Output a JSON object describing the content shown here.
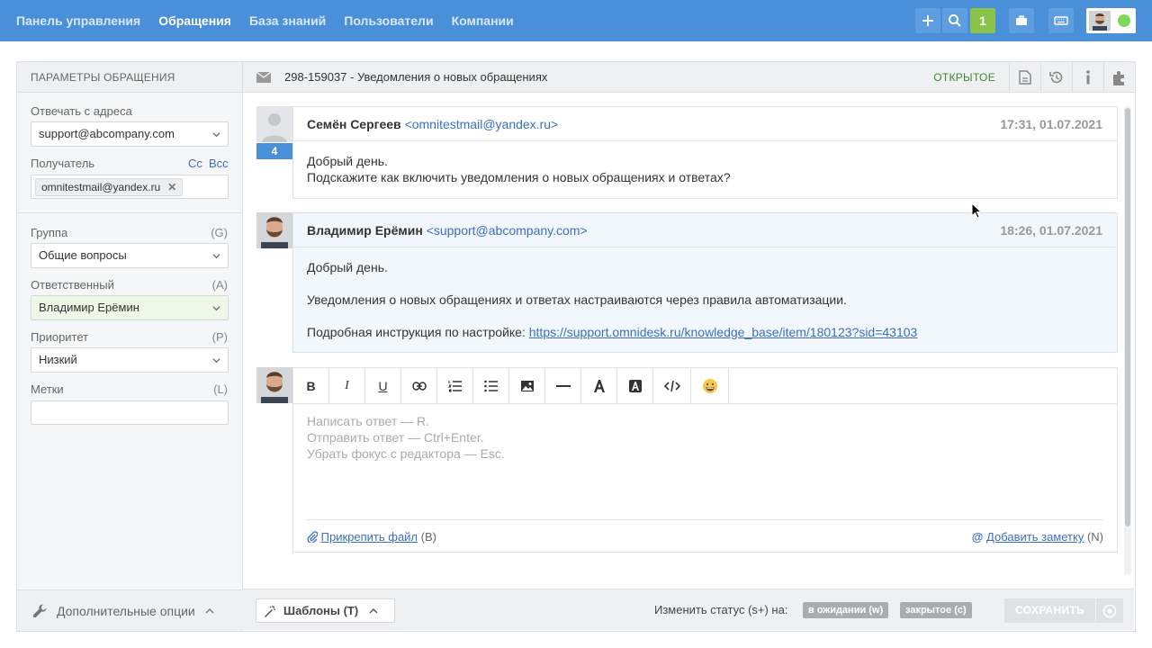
{
  "nav": {
    "items": [
      "Панель управления",
      "Обращения",
      "База знаний",
      "Пользователи",
      "Компании"
    ],
    "active": 1,
    "badge_count": "1"
  },
  "left": {
    "header": "ПАРАМЕТРЫ ОБРАЩЕНИЯ",
    "reply_from_label": "Отвечать с адреса",
    "reply_from_value": "support@abcompany.com",
    "recipient_label": "Получатель",
    "cc": "Cc",
    "bcc": "Bcc",
    "recipient_chip": "omnitestmail@yandex.ru",
    "group_label": "Группа",
    "group_hint": "(G)",
    "group_value": "Общие вопросы",
    "assignee_label": "Ответственный",
    "assignee_hint": "(A)",
    "assignee_value": "Владимир Ерёмин",
    "priority_label": "Приоритет",
    "priority_hint": "(P)",
    "priority_value": "Низкий",
    "tags_label": "Метки",
    "tags_hint": "(L)",
    "footer": "Дополнительные опции"
  },
  "ticket": {
    "title": "298-159037 - Уведомления о новых обращениях",
    "status": "ОТКРЫТОЕ"
  },
  "messages": [
    {
      "author": "Семён Сергеев",
      "email": "<omnitestmail@yandex.ru>",
      "time": "17:31, 01.07.2021",
      "count": "4",
      "lines": [
        "Добрый день.",
        "Подскажите как включить уведомления о новых обращениях и ответах?"
      ]
    },
    {
      "author": "Владимир Ерёмин",
      "email": "<support@abcompany.com>",
      "time": "18:26, 01.07.2021",
      "line1": "Добрый день.",
      "line2": "Уведомления о новых обращениях и ответах настраиваются через правила автоматизации.",
      "line3_prefix": "Подробная инструкция по настройке: ",
      "link": "https://support.omnidesk.ru/knowledge_base/item/180123?sid=43103"
    }
  ],
  "editor": {
    "placeholder_lines": [
      "Написать ответ — R.",
      "Отправить ответ — Ctrl+Enter.",
      "Убрать фокус с редактора — Esc."
    ],
    "attach_label": "Прикрепить файл",
    "attach_hint": " (B)",
    "note_label": "Добавить заметку",
    "note_hint": " (N)"
  },
  "footer": {
    "templates": "Шаблоны (T)",
    "change_status": "Изменить статус (s+) на:",
    "status_pending": "в ожидании (w)",
    "status_closed": "закрытое (c)",
    "save": "СОХРАНИТЬ"
  },
  "colors": {
    "topbar": "#4a90d9",
    "accent_link": "#3a6fc1",
    "status_open": "#3c8a2e",
    "online": "#7ed957"
  }
}
